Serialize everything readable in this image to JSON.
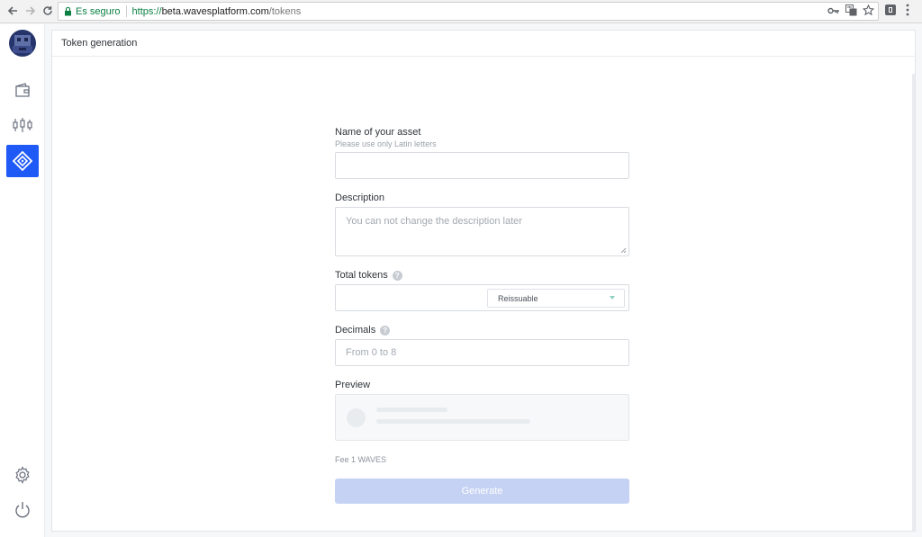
{
  "browser": {
    "secure_label": "Es seguro",
    "url_proto": "https://",
    "url_host": "beta.wavesplatform.com",
    "url_path": "/tokens"
  },
  "page": {
    "title": "Token generation"
  },
  "form": {
    "name_label": "Name of your asset",
    "name_hint": "Please use only Latin letters",
    "name_value": "",
    "description_label": "Description",
    "description_placeholder": "You can not change the description later",
    "total_label": "Total tokens",
    "total_value": "",
    "reissue_selected": "Reissuable",
    "decimals_label": "Decimals",
    "decimals_placeholder": "From 0 to 8",
    "preview_label": "Preview",
    "fee_text": "Fee 1 WAVES",
    "generate_label": "Generate"
  },
  "colors": {
    "accent": "#1f5af6",
    "button_disabled": "#c5d2f3"
  }
}
